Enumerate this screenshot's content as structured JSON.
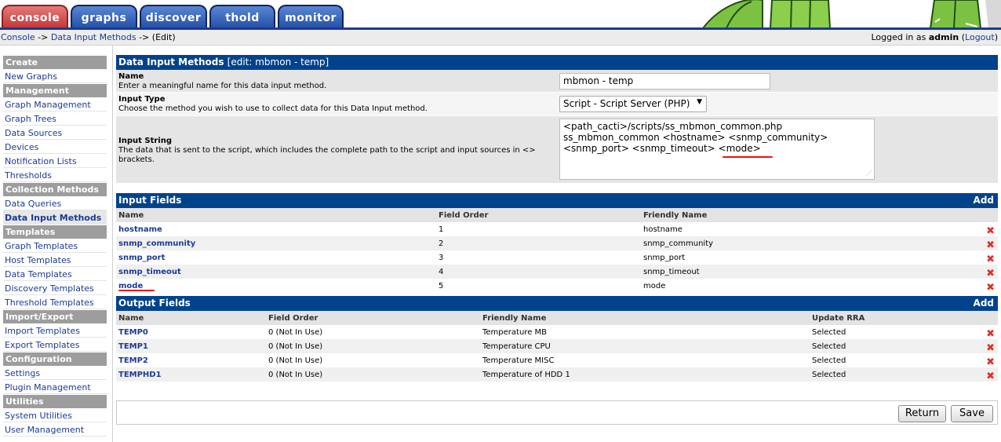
{
  "tabs": [
    {
      "label": "console"
    },
    {
      "label": "graphs"
    },
    {
      "label": "discover"
    },
    {
      "label": "thold"
    },
    {
      "label": "monitor"
    }
  ],
  "breadcrumb": {
    "console": "Console",
    "sep1": " -> ",
    "data_input_methods": "Data Input Methods",
    "sep2": " -> ",
    "current": "(Edit)"
  },
  "login": {
    "prefix": "Logged in as ",
    "user": "admin",
    "open": " (",
    "logout": "Logout",
    "close": ")"
  },
  "sidebar": {
    "sections": [
      {
        "title": "Create",
        "items": [
          "New Graphs"
        ]
      },
      {
        "title": "Management",
        "items": [
          "Graph Management",
          "Graph Trees",
          "Data Sources",
          "Devices",
          "Notification Lists",
          "Thresholds"
        ]
      },
      {
        "title": "Collection Methods",
        "items": [
          "Data Queries",
          "Data Input Methods"
        ]
      },
      {
        "title": "Templates",
        "items": [
          "Graph Templates",
          "Host Templates",
          "Data Templates",
          "Discovery Templates",
          "Threshold Templates"
        ]
      },
      {
        "title": "Import/Export",
        "items": [
          "Import Templates",
          "Export Templates"
        ]
      },
      {
        "title": "Configuration",
        "items": [
          "Settings",
          "Plugin Management"
        ]
      },
      {
        "title": "Utilities",
        "items": [
          "System Utilities",
          "User Management"
        ]
      }
    ],
    "active": "Data Input Methods"
  },
  "form": {
    "header_title": "Data Input Methods",
    "header_edit": "[edit: mbmon - temp]",
    "name_label": "Name",
    "name_desc": "Enter a meaningful name for this data input method.",
    "name_value": "mbmon - temp",
    "type_label": "Input Type",
    "type_desc": "Choose the method you wish to use to collect data for this Data Input method.",
    "type_value": "Script - Script Server (PHP)",
    "string_label": "Input String",
    "string_desc": "The data that is sent to the script, which includes the complete path to the script and input sources in <> brackets.",
    "string_line1": "<path_cacti>/scripts/ss_mbmon_common.php",
    "string_line2": "ss_mbmon_common <hostname> <snmp_community>",
    "string_line3": "<snmp_port> <snmp_timeout> <mode>"
  },
  "input_fields": {
    "title": "Input Fields",
    "add": "Add",
    "columns": [
      "Name",
      "Field Order",
      "Friendly Name"
    ],
    "rows": [
      {
        "name": "hostname",
        "order": "1",
        "friendly": "hostname"
      },
      {
        "name": "snmp_community",
        "order": "2",
        "friendly": "snmp_community"
      },
      {
        "name": "snmp_port",
        "order": "3",
        "friendly": "snmp_port"
      },
      {
        "name": "snmp_timeout",
        "order": "4",
        "friendly": "snmp_timeout"
      },
      {
        "name": "mode",
        "order": "5",
        "friendly": "mode"
      }
    ]
  },
  "output_fields": {
    "title": "Output Fields",
    "add": "Add",
    "columns": [
      "Name",
      "Field Order",
      "Friendly Name",
      "Update RRA"
    ],
    "rows": [
      {
        "name": "TEMP0",
        "order": "0 (Not In Use)",
        "friendly": "Temperature MB",
        "rra": "Selected"
      },
      {
        "name": "TEMP1",
        "order": "0 (Not In Use)",
        "friendly": "Temperature CPU",
        "rra": "Selected"
      },
      {
        "name": "TEMP2",
        "order": "0 (Not In Use)",
        "friendly": "Temperature MISC",
        "rra": "Selected"
      },
      {
        "name": "TEMPHD1",
        "order": "0 (Not In Use)",
        "friendly": "Temperature of HDD 1",
        "rra": "Selected"
      }
    ]
  },
  "buttons": {
    "return": "Return",
    "save": "Save"
  },
  "icons": {
    "delete": "✖"
  },
  "colors": {
    "header_blue": "#00438c",
    "delete_red": "#e0312a",
    "annotation_red": "#ee1111"
  }
}
